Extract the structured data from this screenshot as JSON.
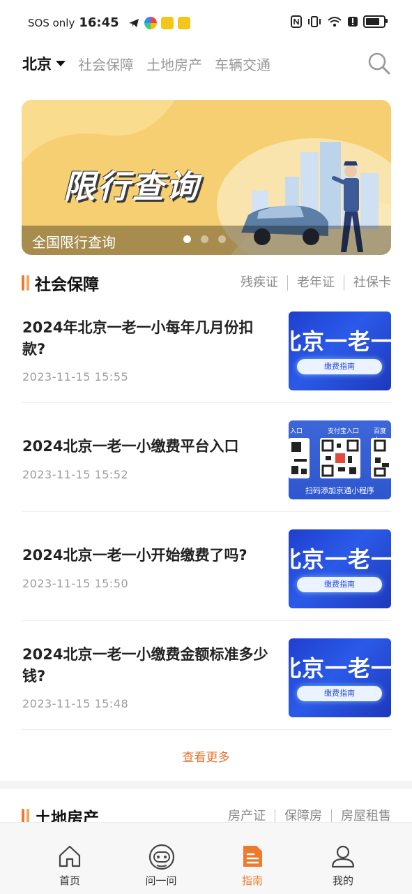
{
  "status_bar": {
    "carrier": "SOS only",
    "time": "16:45",
    "battery_level": 0.85
  },
  "top_nav": {
    "city": "北京",
    "tabs": [
      "社会保障",
      "土地房产",
      "车辆交通"
    ]
  },
  "banner": {
    "title": "限行查询",
    "caption": "全国限行查询",
    "slide_count": 3,
    "active_slide": 1
  },
  "section_social": {
    "title": "社会保障",
    "links": [
      "残疾证",
      "老年证",
      "社保卡"
    ]
  },
  "articles": [
    {
      "title": "2024年北京一老一小每年几月份扣款?",
      "date": "2023-11-15 15:55",
      "thumb": {
        "type": "banner",
        "text": "北京一老一小",
        "button": "缴费指南"
      }
    },
    {
      "title": "2024北京一老一小缴费平台入口",
      "date": "2023-11-15 15:52",
      "thumb": {
        "type": "qr",
        "labels": [
          "入口",
          "支付宝入口",
          "百度小"
        ],
        "caption": "扫码添加京通小程序"
      }
    },
    {
      "title": "2024北京一老一小开始缴费了吗?",
      "date": "2023-11-15 15:50",
      "thumb": {
        "type": "banner",
        "text": "北京一老一小",
        "button": "缴费指南"
      }
    },
    {
      "title": "2024北京一老一小缴费金额标准多少钱?",
      "date": "2023-11-15 15:48",
      "thumb": {
        "type": "banner",
        "text": "北京一老一小",
        "button": "缴费指南"
      }
    }
  ],
  "more_label": "查看更多",
  "section_land": {
    "title": "土地房产",
    "links": [
      "房产证",
      "保障房",
      "房屋租售"
    ]
  },
  "bottom_nav": [
    {
      "label": "首页",
      "icon": "home-icon"
    },
    {
      "label": "问一问",
      "icon": "robot-icon"
    },
    {
      "label": "指南",
      "icon": "guide-icon",
      "active": true
    },
    {
      "label": "我的",
      "icon": "user-icon"
    }
  ],
  "colors": {
    "accent": "#ee7a2c",
    "banner_bg": "#f6cf72",
    "thumb_blue": "#2b5ae8"
  }
}
